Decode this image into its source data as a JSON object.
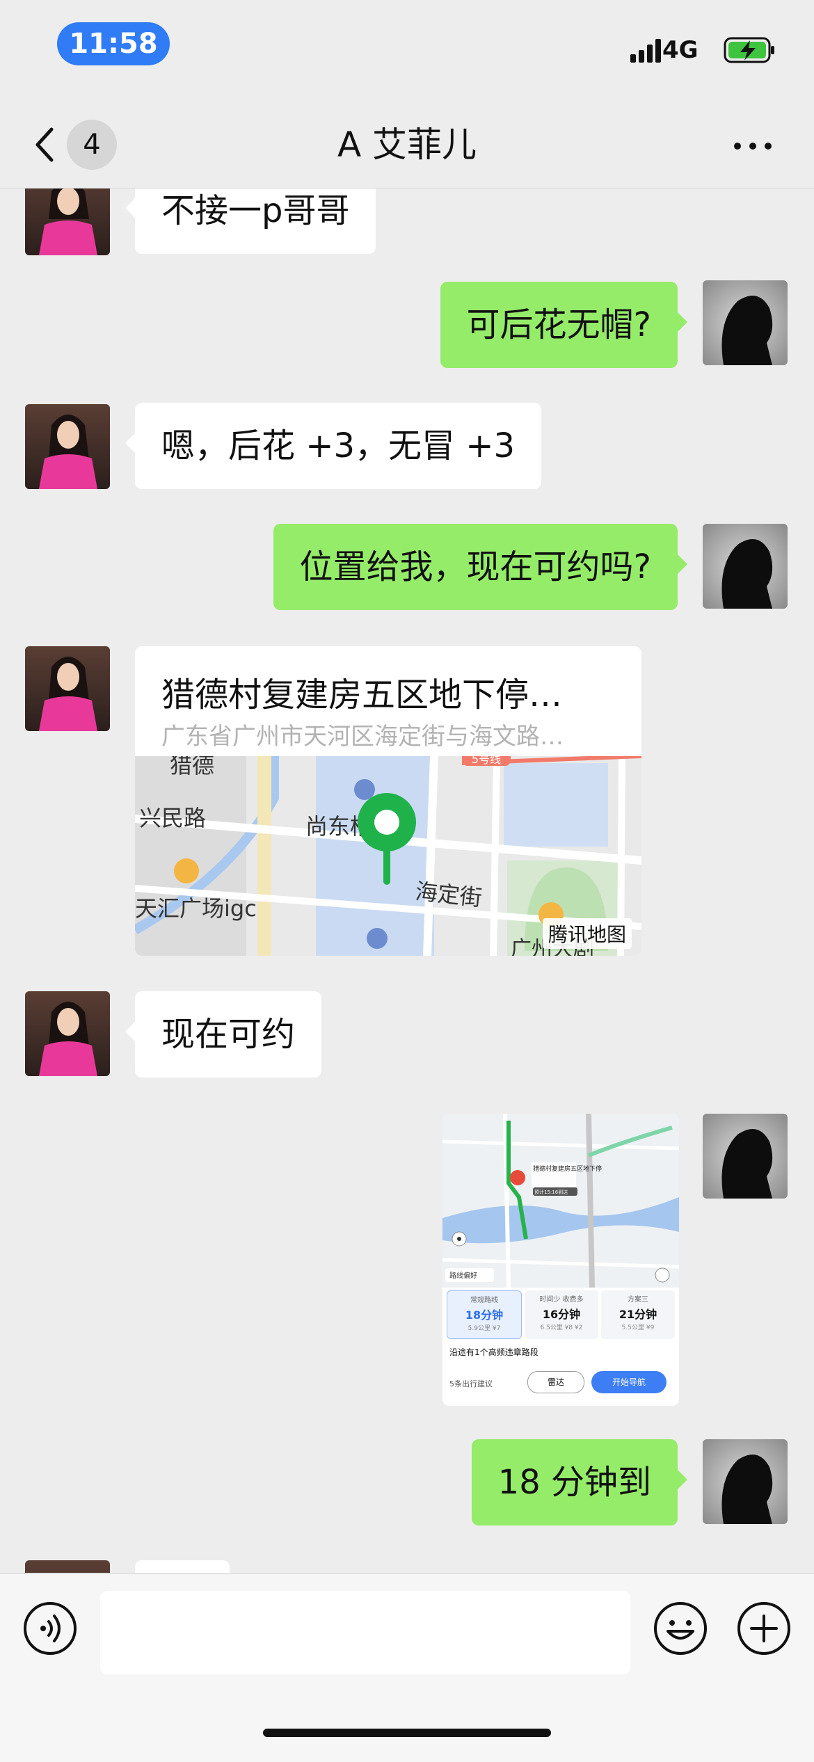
{
  "status_bar": {
    "time": "11:58",
    "network": "4G"
  },
  "nav": {
    "unread_count": "4",
    "title": "A 艾菲儿"
  },
  "messages": [
    {
      "side": "left",
      "text": "不接一p哥哥"
    },
    {
      "side": "right",
      "text": "可后花无帽?"
    },
    {
      "side": "left",
      "text": "嗯，后花 +3，无冒 +3"
    },
    {
      "side": "right",
      "text": "位置给我，现在可约吗?"
    },
    {
      "side": "left",
      "text": "现在可约"
    },
    {
      "side": "right",
      "text": "18 分钟到"
    }
  ],
  "location_card": {
    "name": "猎德村复建房五区地下停…",
    "address": "广东省广州市天河区海定街与海文路…",
    "map_labels": {
      "road1": "兴民路",
      "road2": "海定街",
      "poi1": "尚东柏府",
      "poi2": "天汇广场igc",
      "top": "猎德",
      "metro": "5号线",
      "bottom": "广州大剧"
    },
    "map_brand": "腾讯地图"
  },
  "nav_screenshot": {
    "map_labels": {
      "dest": "猎德村复建房五区地下停",
      "eta": "预计15:16到达",
      "route_pref": "路线偏好"
    },
    "routes": [
      {
        "label": "常规路线",
        "time": "18分钟",
        "detail": "5.9公里 ¥7"
      },
      {
        "label": "时间少 收费多",
        "time": "16分钟",
        "detail": "6.5公里 ¥8 ¥2"
      },
      {
        "label": "方案三",
        "time": "21分钟",
        "detail": "5.5公里 ¥9"
      }
    ],
    "toll_note": "沿途有1个高频违章路段",
    "tips": "5条出行建议",
    "radar": "雷达",
    "start": "开始导航"
  },
  "colors": {
    "self_bubble": "#95ec69",
    "other_bubble": "#ffffff",
    "time_pill": "#2f7cf6"
  }
}
